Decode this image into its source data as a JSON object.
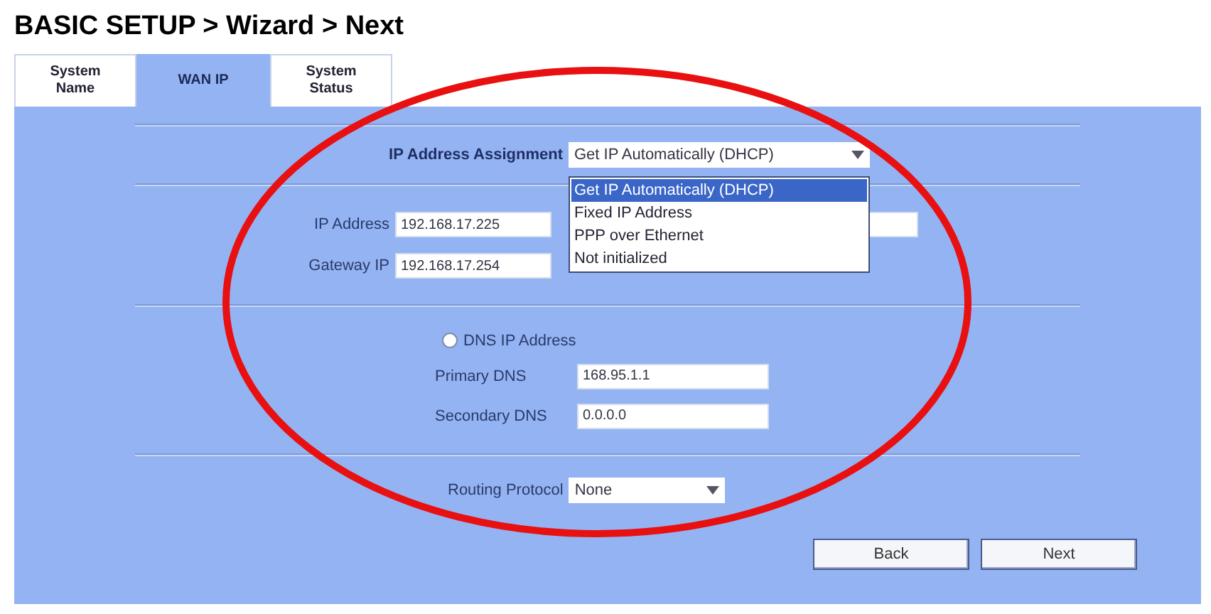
{
  "page_title": "BASIC SETUP > Wizard > Next",
  "tabs": [
    {
      "label": "System Name",
      "selected": false
    },
    {
      "label": "WAN IP",
      "selected": true
    },
    {
      "label": "System Status",
      "selected": false
    }
  ],
  "ip_assignment": {
    "label": "IP Address Assignment",
    "value": "Get IP Automatically (DHCP)",
    "expanded": true,
    "options": [
      {
        "label": "Get IP Automatically (DHCP)",
        "selected": true
      },
      {
        "label": "Fixed IP Address",
        "selected": false
      },
      {
        "label": "PPP over Ethernet",
        "selected": false
      },
      {
        "label": "Not initialized",
        "selected": false
      }
    ]
  },
  "ip_address": {
    "label": "IP Address",
    "value": "192.168.17.225"
  },
  "gateway_ip": {
    "label": "Gateway IP",
    "value": "192.168.17.254"
  },
  "dns": {
    "label": "DNS IP Address",
    "checked": false
  },
  "primary_dns": {
    "label": "Primary DNS",
    "value": "168.95.1.1"
  },
  "secondary_dns": {
    "label": "Secondary DNS",
    "value": "0.0.0.0"
  },
  "routing_protocol": {
    "label": "Routing Protocol",
    "value": "None"
  },
  "buttons": [
    "Back",
    "Next"
  ]
}
